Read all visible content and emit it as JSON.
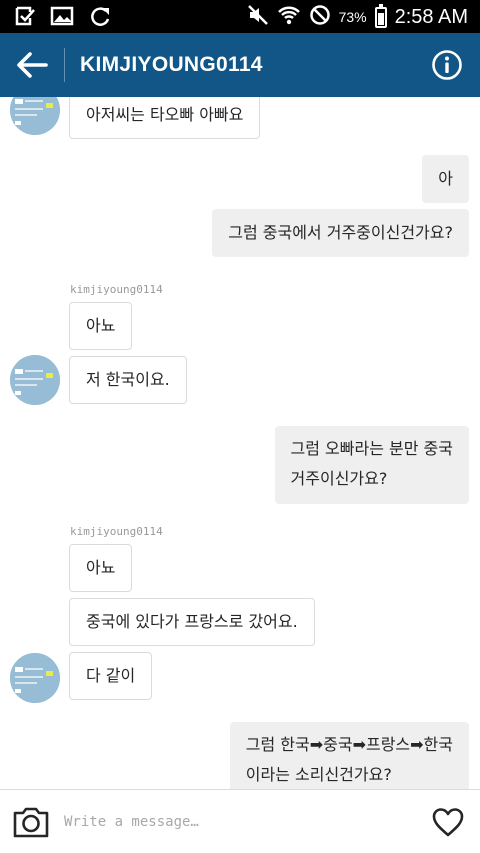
{
  "status_bar": {
    "battery": "73%",
    "time": "2:58 AM",
    "left_icons": [
      "check-square-icon",
      "image-icon",
      "refresh-icon"
    ],
    "right_icons": [
      "mute-icon",
      "wifi-icon",
      "block-icon",
      "battery-icon"
    ]
  },
  "header": {
    "title": "KIMJIYOUNG0114",
    "back_icon": "arrow-left-icon",
    "info_icon": "info-icon",
    "color": "#125688"
  },
  "messages": [
    {
      "side": "in",
      "text": "아저씨는 타오빠 아빠요"
    },
    {
      "side": "out",
      "text": "아"
    },
    {
      "side": "out",
      "text": "그럼 중국에서 거주중이신건가요?"
    },
    {
      "side": "in",
      "sender": "kimjiyoung0114",
      "text": "아뇨"
    },
    {
      "side": "in",
      "text": "저 한국이요."
    },
    {
      "side": "out",
      "lines": [
        "그럼 오빠라는 분만 중국",
        "거주이신가요?"
      ]
    },
    {
      "side": "in",
      "sender": "kimjiyoung0114",
      "text": "아뇨"
    },
    {
      "side": "in",
      "text": "중국에 있다가 프랑스로 갔어요."
    },
    {
      "side": "in",
      "text": "다 같이"
    },
    {
      "side": "out",
      "lines": [
        "그럼 한국➡중국➡프랑스➡한국",
        "이라는 소리신건가요?"
      ]
    }
  ],
  "composer": {
    "placeholder": "Write a message…",
    "camera_icon": "camera-icon",
    "heart_icon": "heart-icon"
  }
}
